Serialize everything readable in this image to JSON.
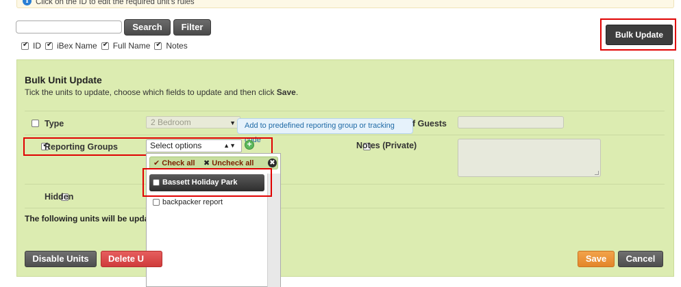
{
  "info": {
    "text": "Click on the ID to edit the required unit's rules"
  },
  "search": {
    "value": "",
    "search_label": "Search",
    "filter_label": "Filter"
  },
  "columns": [
    {
      "label": "ID",
      "checked": true
    },
    {
      "label": "iBex Name",
      "checked": true
    },
    {
      "label": "Full Name",
      "checked": true
    },
    {
      "label": "Notes",
      "checked": true
    }
  ],
  "bulk_update_label": "Bulk Update",
  "panel": {
    "title": "Bulk Unit Update",
    "subtitle_prefix": "Tick the units to update, choose which fields to update and then click ",
    "subtitle_bold": "Save",
    "subtitle_suffix": ".",
    "fields": {
      "type_label": "Type",
      "type_value": "2 Bedroom",
      "reporting_label": "Reporting Groups",
      "reporting_placeholder": "Select options",
      "tooltip": "Add to predefined reporting group or tracking code",
      "guests_label": "f Guests",
      "notes_label": "Notes (Private)",
      "hidden_label": "Hidden"
    },
    "dropdown": {
      "check_all": "Check all",
      "uncheck_all": "Uncheck all",
      "items": [
        "Bassett Holiday Park",
        "backpacker report"
      ]
    },
    "units_text": "The following units will be upda",
    "buttons": {
      "disable": "Disable Units",
      "delete": "Delete U",
      "save": "Save",
      "cancel": "Cancel"
    }
  }
}
